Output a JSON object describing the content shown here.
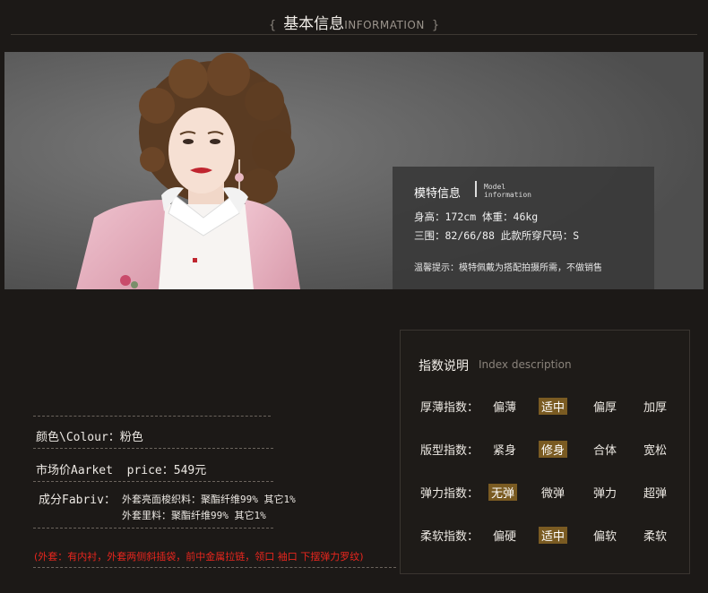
{
  "header": {
    "title_cn": "基本信息",
    "title_en": "INFORMATION",
    "brace_left": "{",
    "brace_right": "}"
  },
  "model_info": {
    "title": "模特信息",
    "subtitle": "Model information",
    "line1": "身高：172cm  体重：46kg",
    "line2": "三围：82/66/88  此款所穿尺码：S",
    "note": "温馨提示：模特佩戴为搭配拍摄所需，不做销售"
  },
  "attributes": {
    "colour": "颜色\\Colour：粉色",
    "price": "市场价Aarket  price：549元",
    "fabric_label": "成分Fabriv：",
    "fabric_line1": "外套亮面梭织料：聚酯纤维99% 其它1%",
    "fabric_line2": "外套里料：聚酯纤维99% 其它1%",
    "remark": "(外套：有内衬，外套两侧斜插袋，前中金属拉链，领口 袖口 下摆弹力罗纹)"
  },
  "index_description": {
    "title": "指数说明",
    "title_en": "Index description",
    "rows": [
      {
        "label": "厚薄指数：",
        "options": [
          "偏薄",
          "适中",
          "偏厚",
          "加厚"
        ],
        "selected": 1
      },
      {
        "label": "版型指数：",
        "options": [
          "紧身",
          "修身",
          "合体",
          "宽松"
        ],
        "selected": 1
      },
      {
        "label": "弹力指数：",
        "options": [
          "无弹",
          "微弹",
          "弹力",
          "超弹"
        ],
        "selected": 0
      },
      {
        "label": "柔软指数：",
        "options": [
          "偏硬",
          "适中",
          "偏软",
          "柔软"
        ],
        "selected": 1
      }
    ]
  },
  "colors": {
    "background": "#1c1917",
    "selected_option": "#7a5b22",
    "remark_red": "#e8261e",
    "jacket_pink": "#e8b2c0"
  },
  "icons": {
    "photo": "model-photo"
  }
}
